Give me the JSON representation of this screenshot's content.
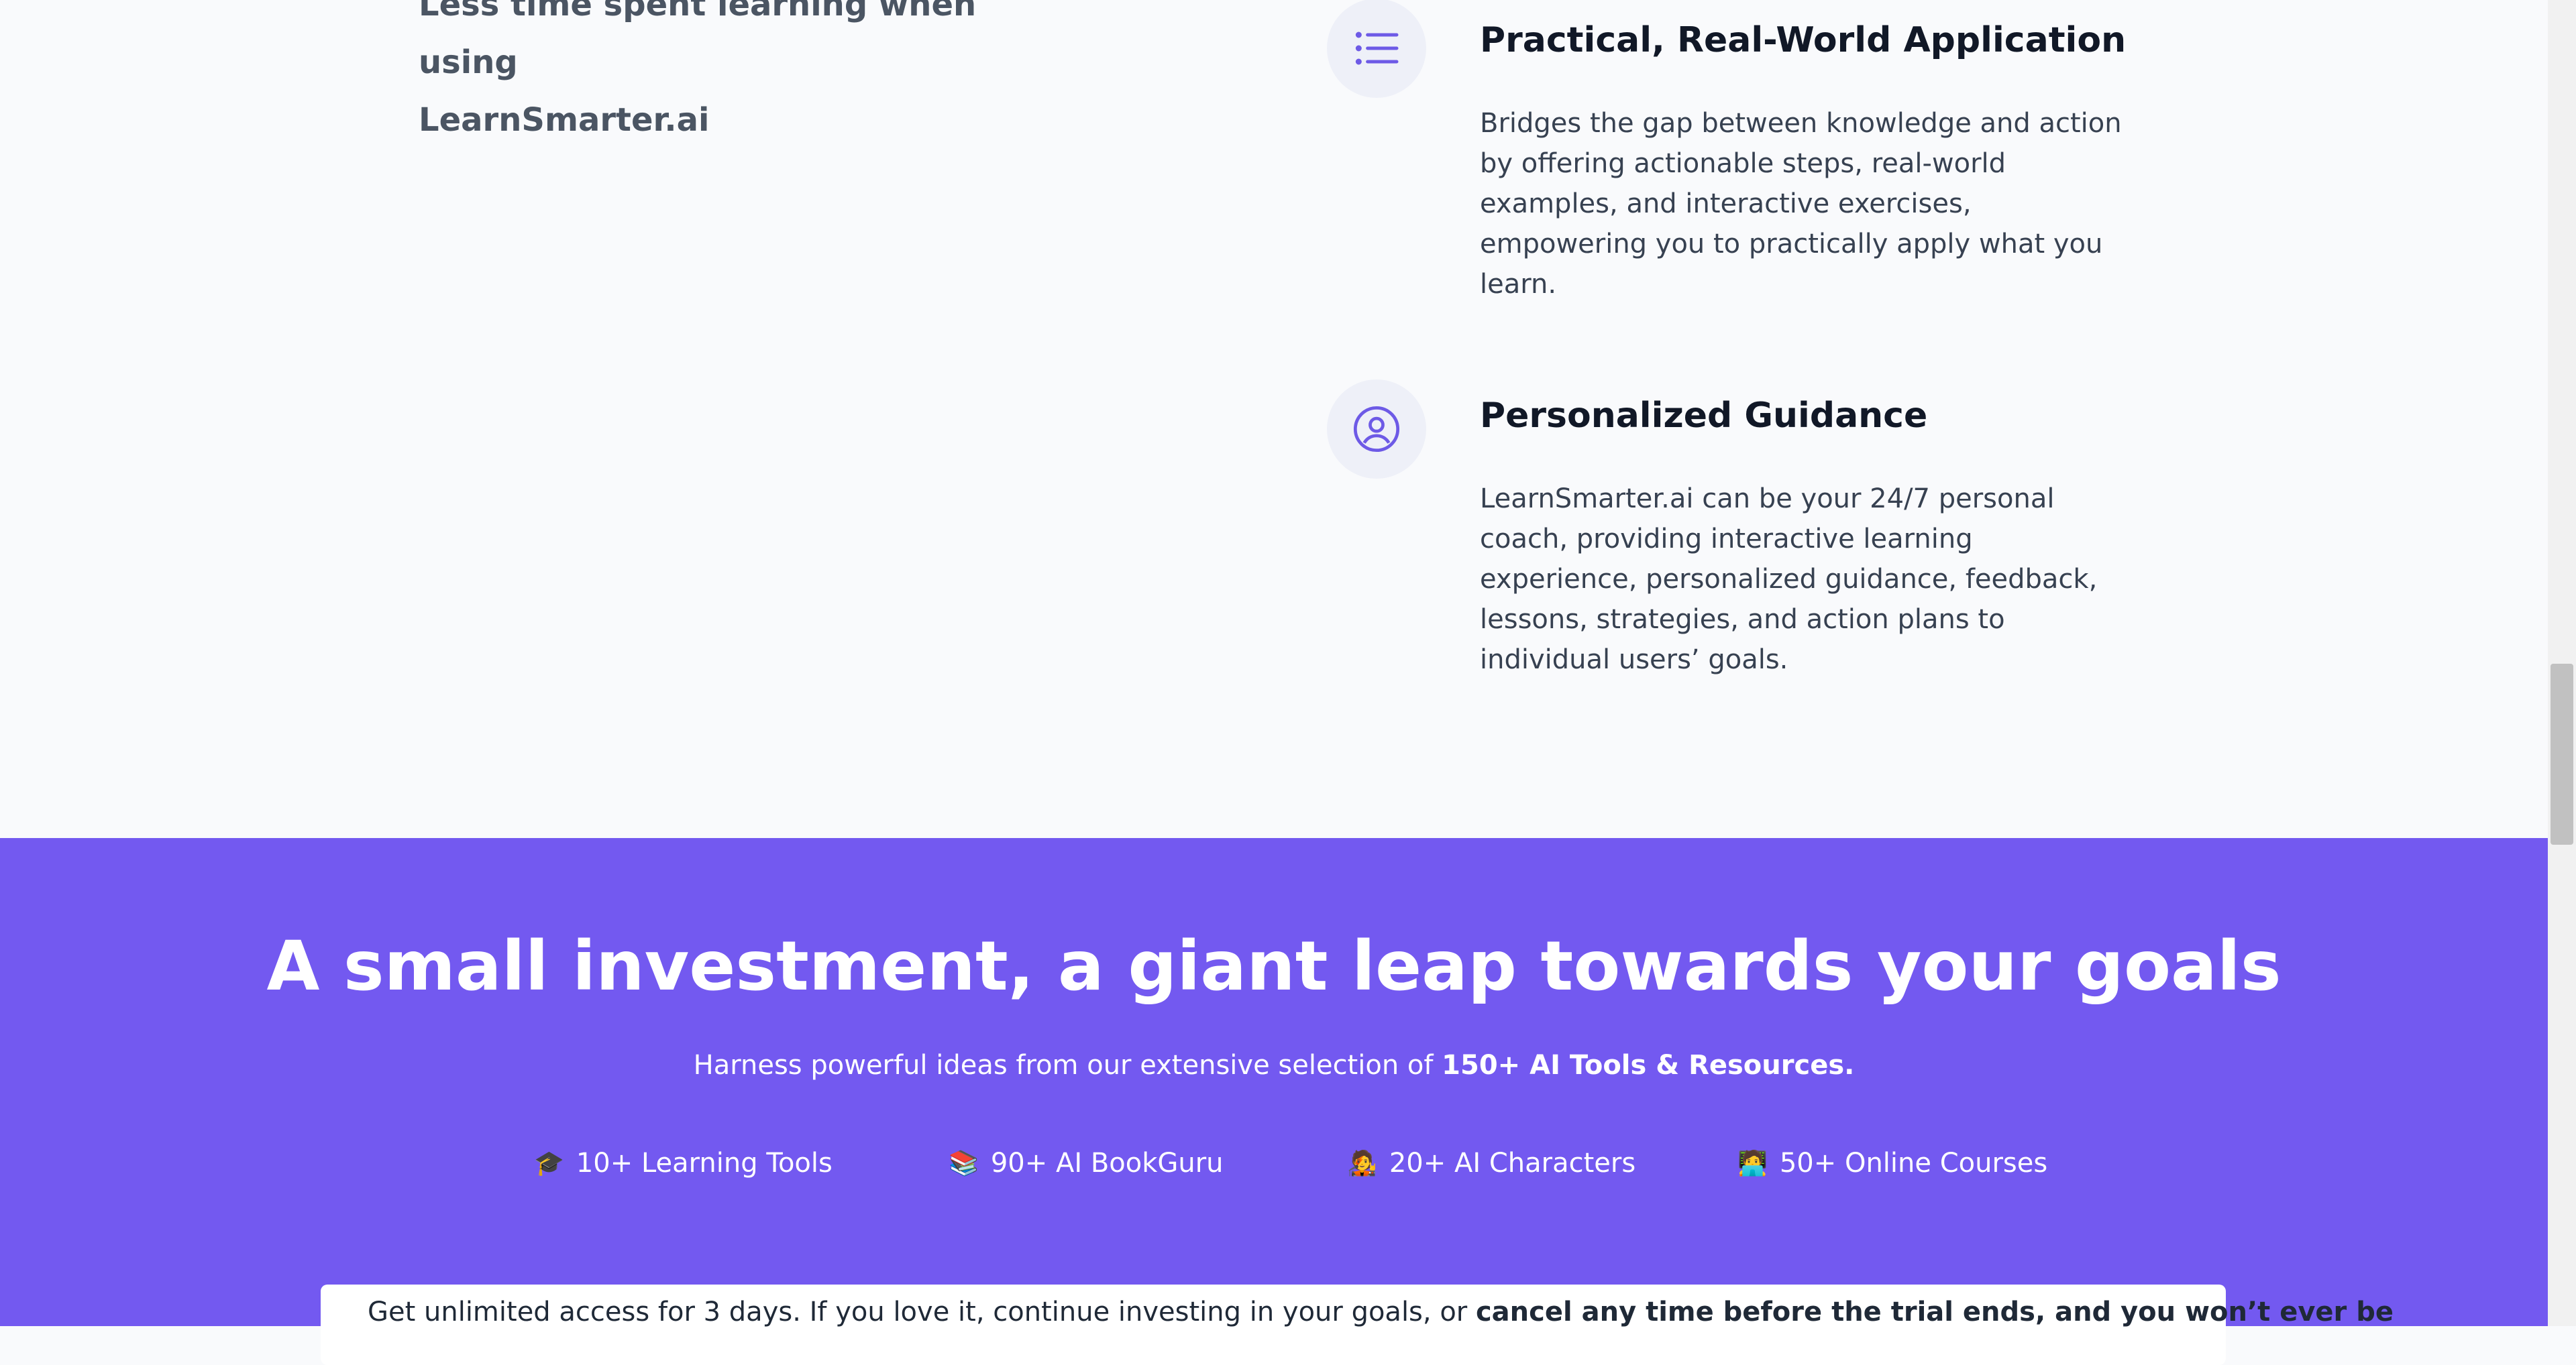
{
  "left_panel": {
    "line1": "Less time spent learning when using",
    "line2": "LearnSmarter.ai"
  },
  "features": [
    {
      "icon": "list-icon",
      "title": "Practical, Real-World Application",
      "desc": [
        "Bridges the gap between knowledge and action",
        "by offering actionable steps, real-world",
        "examples, and interactive exercises,",
        "empowering you to practically apply what you",
        "learn."
      ]
    },
    {
      "icon": "user-circle-icon",
      "title": "Personalized Guidance",
      "desc": [
        "LearnSmarter.ai can be your 24/7 personal",
        "coach, providing interactive learning",
        "experience, personalized guidance, feedback,",
        "lessons, strategies, and action plans to",
        "individual users’ goals."
      ]
    }
  ],
  "band": {
    "headline": "A small investment, a giant leap towards your goals",
    "sub_prefix": "Harness powerful ideas from our extensive selection of ",
    "sub_bold": "150+ AI Tools & Resources.",
    "stats": [
      {
        "icon": "graduation-cap-icon",
        "emoji": "🎓",
        "label": "10+ Learning Tools"
      },
      {
        "icon": "books-icon",
        "emoji": "📚",
        "label": "90+ AI BookGuru"
      },
      {
        "icon": "character-icon",
        "emoji": "🧑‍🎤",
        "label": "20+ AI Characters"
      },
      {
        "icon": "person-laptop-icon",
        "emoji": "🧑‍💻",
        "label": "50+ Online Courses"
      }
    ],
    "notice_prefix": "Get unlimited access for 3 days. If you love it, continue investing in your goals, or ",
    "notice_bold": "cancel any time before the trial ends, and you won’t ever be"
  },
  "colors": {
    "accent": "#7359f0",
    "icon_stroke": "#6d5ae6",
    "page_bg": "#f9fafc"
  }
}
